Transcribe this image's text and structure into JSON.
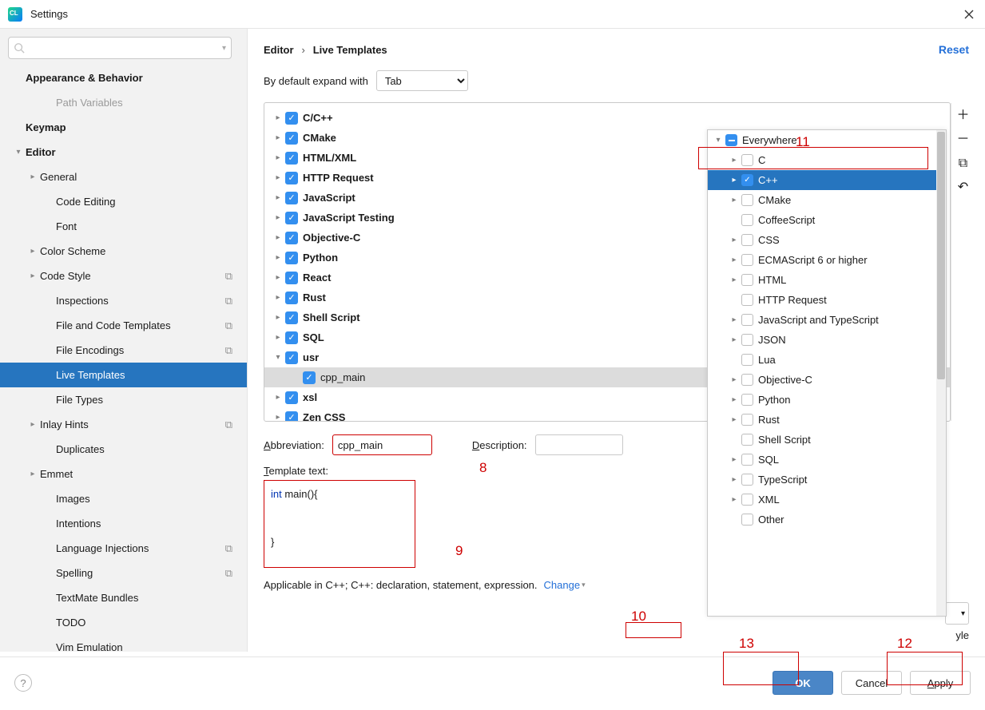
{
  "window": {
    "title": "Settings"
  },
  "sidebar": {
    "search_placeholder": "",
    "items": [
      {
        "label": "Appearance & Behavior",
        "bold": true,
        "depth": 0
      },
      {
        "label": "Path Variables",
        "depth": 2,
        "dim": true
      },
      {
        "label": "Keymap",
        "bold": true,
        "depth": 0
      },
      {
        "label": "Editor",
        "bold": true,
        "depth": 0,
        "arrow": "▾"
      },
      {
        "label": "General",
        "depth": 1,
        "arrow": "▸"
      },
      {
        "label": "Code Editing",
        "depth": 2
      },
      {
        "label": "Font",
        "depth": 2
      },
      {
        "label": "Color Scheme",
        "depth": 1,
        "arrow": "▸"
      },
      {
        "label": "Code Style",
        "depth": 1,
        "arrow": "▸",
        "sub": true
      },
      {
        "label": "Inspections",
        "depth": 2,
        "sub": true
      },
      {
        "label": "File and Code Templates",
        "depth": 2,
        "sub": true
      },
      {
        "label": "File Encodings",
        "depth": 2,
        "sub": true
      },
      {
        "label": "Live Templates",
        "depth": 2,
        "selected": true
      },
      {
        "label": "File Types",
        "depth": 2
      },
      {
        "label": "Inlay Hints",
        "depth": 1,
        "arrow": "▸",
        "sub": true
      },
      {
        "label": "Duplicates",
        "depth": 2
      },
      {
        "label": "Emmet",
        "depth": 1,
        "arrow": "▸"
      },
      {
        "label": "Images",
        "depth": 2
      },
      {
        "label": "Intentions",
        "depth": 2
      },
      {
        "label": "Language Injections",
        "depth": 2,
        "sub": true
      },
      {
        "label": "Spelling",
        "depth": 2,
        "sub": true
      },
      {
        "label": "TextMate Bundles",
        "depth": 2
      },
      {
        "label": "TODO",
        "depth": 2
      },
      {
        "label": "Vim Emulation",
        "depth": 2
      }
    ]
  },
  "breadcrumb": {
    "root": "Editor",
    "leaf": "Live Templates",
    "reset": "Reset"
  },
  "expand": {
    "label": "By default expand with",
    "value": "Tab"
  },
  "templates": {
    "groups": [
      {
        "label": "C/C++",
        "arrow": "▸"
      },
      {
        "label": "CMake",
        "arrow": "▸"
      },
      {
        "label": "HTML/XML",
        "arrow": "▸"
      },
      {
        "label": "HTTP Request",
        "arrow": "▸"
      },
      {
        "label": "JavaScript",
        "arrow": "▸"
      },
      {
        "label": "JavaScript Testing",
        "arrow": "▸"
      },
      {
        "label": "Objective-C",
        "arrow": "▸"
      },
      {
        "label": "Python",
        "arrow": "▸"
      },
      {
        "label": "React",
        "arrow": "▸"
      },
      {
        "label": "Rust",
        "arrow": "▸"
      },
      {
        "label": "Shell Script",
        "arrow": "▸"
      },
      {
        "label": "SQL",
        "arrow": "▸"
      },
      {
        "label": "usr",
        "arrow": "▾",
        "children": [
          {
            "label": "cpp_main",
            "selected": true
          }
        ]
      },
      {
        "label": "xsl",
        "arrow": "▸"
      },
      {
        "label": "Zen CSS",
        "arrow": "▸"
      }
    ]
  },
  "context": {
    "root": "Everywhere",
    "items": [
      {
        "label": "C",
        "arrow": "▸"
      },
      {
        "label": "C++",
        "arrow": "▸",
        "checked": true,
        "selected": true
      },
      {
        "label": "CMake",
        "arrow": "▸"
      },
      {
        "label": "CoffeeScript"
      },
      {
        "label": "CSS",
        "arrow": "▸"
      },
      {
        "label": "ECMAScript 6 or higher",
        "arrow": "▸"
      },
      {
        "label": "HTML",
        "arrow": "▸"
      },
      {
        "label": "HTTP Request"
      },
      {
        "label": "JavaScript and TypeScript",
        "arrow": "▸"
      },
      {
        "label": "JSON",
        "arrow": "▸"
      },
      {
        "label": "Lua"
      },
      {
        "label": "Objective-C",
        "arrow": "▸"
      },
      {
        "label": "Python",
        "arrow": "▸"
      },
      {
        "label": "Rust",
        "arrow": "▸"
      },
      {
        "label": "Shell Script"
      },
      {
        "label": "SQL",
        "arrow": "▸"
      },
      {
        "label": "TypeScript",
        "arrow": "▸"
      },
      {
        "label": "XML",
        "arrow": "▸"
      },
      {
        "label": "Other"
      }
    ]
  },
  "form": {
    "abbr_label": "Abbreviation:",
    "abbr_value": "cpp_main",
    "desc_label": "Description:",
    "desc_value": "",
    "tpl_label": "Template text:",
    "tpl_text_kw": "int",
    "tpl_text_rest1": " main(){",
    "tpl_text_rest2": "}",
    "applicable": "Applicable in C++; C++: declaration, statement, expression.",
    "change": "Change",
    "style_partial": "yle"
  },
  "buttons": {
    "ok": "OK",
    "cancel": "Cancel",
    "apply": "Apply"
  },
  "annotations": {
    "n8": "8",
    "n9": "9",
    "n10": "10",
    "n11": "11",
    "n12": "12",
    "n13": "13"
  }
}
